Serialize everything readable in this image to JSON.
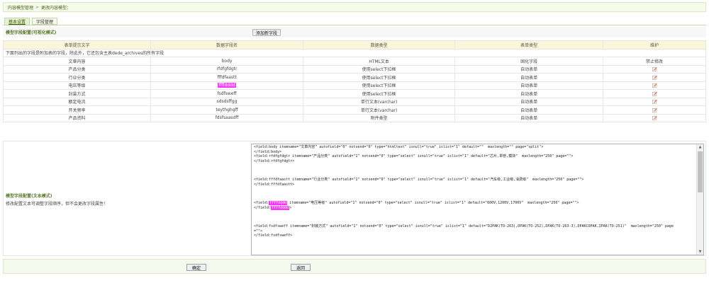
{
  "breadcrumb": {
    "part1": "内容模型管理",
    "sep": ">",
    "part2": "更改内容模型："
  },
  "tabs": [
    {
      "label": "基本设置"
    },
    {
      "label": "字段管理"
    }
  ],
  "visual_section": {
    "title": "模型字段配置(可视化模式)",
    "add_button": "添加新字段"
  },
  "table": {
    "headers": [
      "表单提示文字",
      "数据字段名",
      "数据类型",
      "表单类型",
      "维护"
    ],
    "note": "下面列出的字段是附加表的字段，除此外，它还包含主表dede_archives的所有字段",
    "rows": [
      {
        "label": "文章内容",
        "field": "body",
        "type": "HTML文本",
        "form": "固化字段",
        "action": "禁止修改"
      },
      {
        "label": "产品分类",
        "field": "rfdfgfdgtr",
        "type": "使用select下拉框",
        "form": "自动表单",
        "action": "edit-icon"
      },
      {
        "label": "行业分类",
        "field": "fffdfaastt",
        "type": "使用select下拉框",
        "form": "自动表单",
        "action": "edit-icon"
      },
      {
        "label": "电压等级",
        "field": "ffffdddd",
        "type": "使用select下拉框",
        "form": "自动表单",
        "action": "edit-icon"
      },
      {
        "label": "封装方式",
        "field": "fsdfsweff",
        "type": "使用select下拉框",
        "form": "自动表单",
        "action": "edit-icon"
      },
      {
        "label": "额定电流",
        "field": "sdsdsffgg",
        "type": "单行文本(varchar)",
        "form": "自动表单",
        "action": "edit-icon"
      },
      {
        "label": "开关频率",
        "field": "teythghgff",
        "type": "单行文本(varchar)",
        "form": "自动表单",
        "action": "edit-icon"
      },
      {
        "label": "产品资料",
        "field": "fdsfsaasdff",
        "type": "附件类型",
        "form": "自动表单",
        "action": "edit-icon"
      }
    ]
  },
  "text_section": {
    "title": "模型字段配置(文本模式)",
    "desc": "修改配置文本可调整字段顺序，但不会更改字段属性！",
    "code": {
      "l1": "<field:body itemname=\"文章内容\" autofield=\"0\" notsend=\"0\" type=\"htmltext\" isnull=\"true\" islist=\"1\" default=\"\"  maxlength=\"\" page=\"split\">",
      "l2": "</field:body>",
      "l3": "<field:rfdfgfdgtr itemname=\"产品分类\" autofield=\"1\" notsend=\"0\" type=\"select\" isnull=\"true\" islist=\"1\" default=\"芯片,单管,模块\"  maxlength=\"250\" page=\"\">",
      "l4": "</field:rfdfgfdgtr>",
      "l5": "<field:fffdfaastt itemname=\"行业分类\" autofield=\"1\" notsend=\"0\" type=\"select\" isnull=\"true\" islist=\"1\" default=\"汽车级,工业级,消费级\"  maxlength=\"250\" page=\"\">",
      "l6": "</field:fffdfaastt>",
      "l7a": "<field:",
      "l7hl": "ffffdddd",
      "l7b": " itemname=\"电压等级\" autofield=\"1\" notsend=\"0\" type=\"select\" isnull=\"true\" islist=\"1\" default=\"600V,1200V,1700V\"  maxlength=\"250\" page=\"\">",
      "l8a": "</field:",
      "l8hl": "ffffdddd",
      "l8b": ">",
      "l9": "<field:fsdfsweff itemname=\"封装方式\" autofield=\"1\" notsend=\"0\" type=\"select\" isnull=\"true\" islist=\"1\" default=\"D2PAK(TO-263),DPAK(TO-252),DPAK(TO-263-3),DPAKCOPAK,IPAK(TO-251)\"  maxlength=\"250\" page",
      "l10": "=\"\">",
      "l11": "</field:fsdfsweff>"
    }
  },
  "footer": {
    "ok_button": "确定",
    "back_button": "返回"
  },
  "colors": {
    "accent_green": "#5b7b2a",
    "highlight": "#ff33ff",
    "header_bg": "#fbf6d9"
  }
}
